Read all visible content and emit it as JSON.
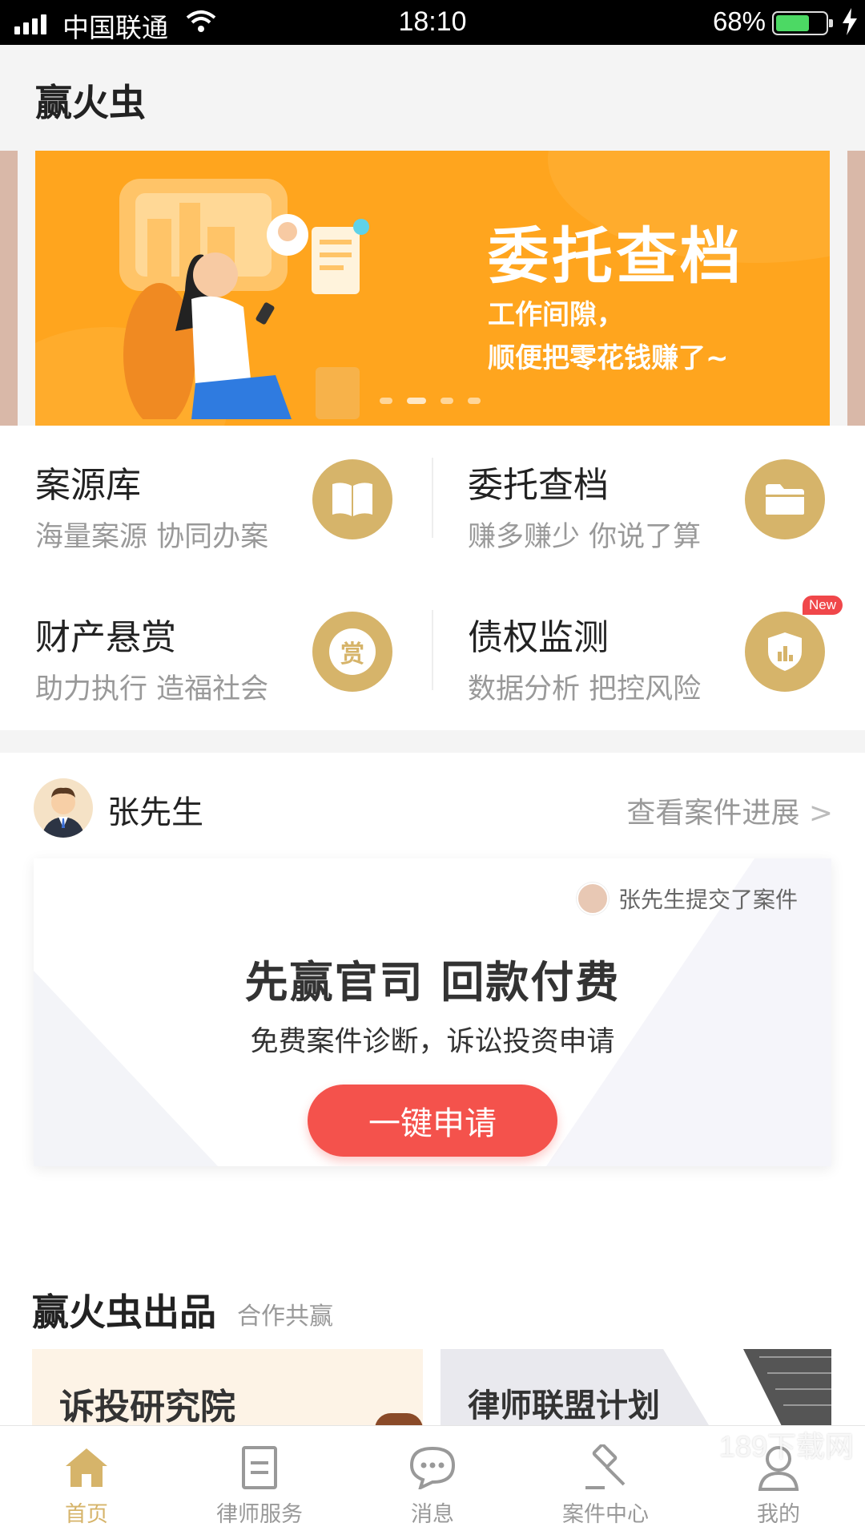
{
  "status_bar": {
    "carrier": "中国联通",
    "time": "18:10",
    "battery_pct": "68%",
    "battery_level": 0.68
  },
  "header": {
    "title": "赢火虫"
  },
  "banner": {
    "title": "委托查档",
    "subtitle_line1": "工作间隙，",
    "subtitle_line2": "顺便把零花钱赚了~",
    "accent_color": "#ffa51e",
    "page_count": 4,
    "active_index": 1
  },
  "features": [
    {
      "title": "案源库",
      "subtitle": "海量案源 协同办案",
      "icon": "book-icon"
    },
    {
      "title": "委托查档",
      "subtitle": "赚多赚少 你说了算",
      "icon": "folder-icon"
    },
    {
      "title": "财产悬赏",
      "subtitle": "助力执行 造福社会",
      "icon": "reward-icon",
      "icon_text": "赏"
    },
    {
      "title": "债权监测",
      "subtitle": "数据分析 把控风险",
      "icon": "shield-chart-icon",
      "badge": "New"
    }
  ],
  "user": {
    "name": "张先生",
    "progress_link": "查看案件进展",
    "submit_note": "张先生提交了案件"
  },
  "promo": {
    "title": "先赢官司 回款付费",
    "subtitle": "免费案件诊断，诉讼投资申请",
    "button": "一键申请",
    "button_color": "#f4524c"
  },
  "products": {
    "title": "赢火虫出品",
    "subtitle": "合作共赢",
    "cards": [
      "诉投研究院",
      "律师联盟计划"
    ]
  },
  "tab_bar": {
    "active_color": "#d6b46a",
    "tabs": [
      {
        "label": "首页",
        "icon": "home-icon",
        "active": true
      },
      {
        "label": "律师服务",
        "icon": "document-icon",
        "active": false
      },
      {
        "label": "消息",
        "icon": "chat-bubble-icon",
        "active": false
      },
      {
        "label": "案件中心",
        "icon": "gavel-icon",
        "active": false
      },
      {
        "label": "我的",
        "icon": "user-icon",
        "active": false
      }
    ]
  },
  "watermark": "189下载网"
}
